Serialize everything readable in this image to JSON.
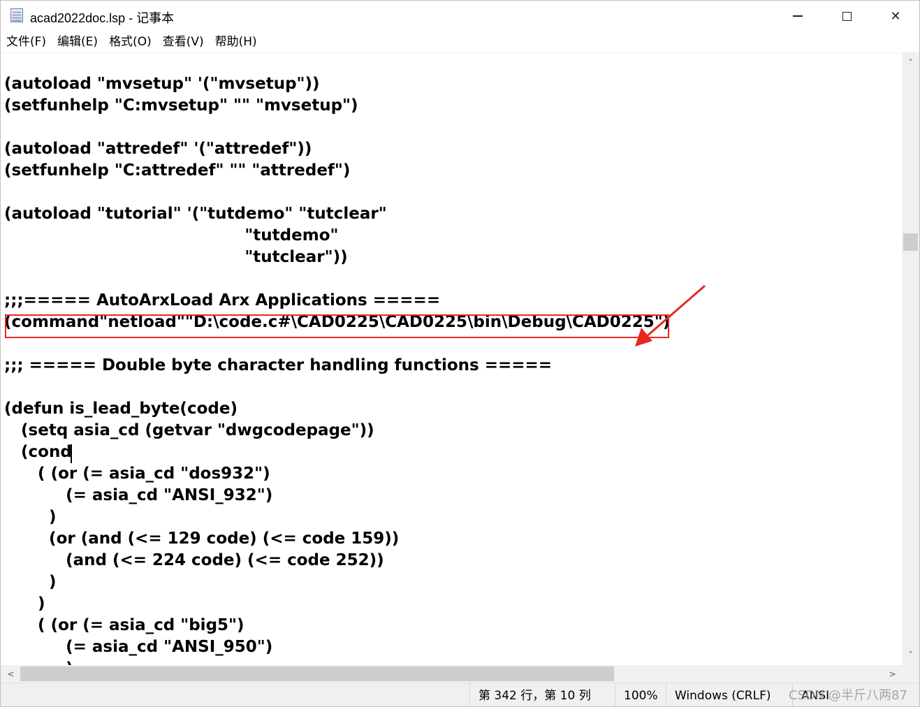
{
  "window": {
    "title": "acad2022doc.lsp - 记事本",
    "minimize_icon": "minimize-icon",
    "maximize_icon": "maximize-icon",
    "close_icon": "close-icon",
    "close_glyph": "✕"
  },
  "menu": {
    "items": [
      "文件(F)",
      "编辑(E)",
      "格式(O)",
      "查看(V)",
      "帮助(H)"
    ]
  },
  "editor": {
    "text": "(autoload \"mvsetup\" '(\"mvsetup\"))\n(setfunhelp \"C:mvsetup\" \"\" \"mvsetup\")\n\n(autoload \"attredef\" '(\"attredef\"))\n(setfunhelp \"C:attredef\" \"\" \"attredef\")\n\n(autoload \"tutorial\" '(\"tutdemo\" \"tutclear\"\n                                           \"tutdemo\"\n                                           \"tutclear\"))\n\n;;;===== AutoArxLoad Arx Applications =====\n(command\"netload\"\"D:\\code.c#\\CAD0225\\CAD0225\\bin\\Debug\\CAD0225\")\n\n;;; ===== Double byte character handling functions =====\n\n(defun is_lead_byte(code)\n   (setq asia_cd (getvar \"dwgcodepage\"))\n   (cond\n      ( (or (= asia_cd \"dos932\")\n           (= asia_cd \"ANSI_932\")\n        )\n        (or (and (<= 129 code) (<= code 159))\n           (and (<= 224 code) (<= code 252))\n        )\n      )\n      ( (or (= asia_cd \"big5\")\n           (= asia_cd \"ANSI_950\")\n           )",
    "annotation": {
      "box_color": "#e8281f",
      "arrow_color": "#e8281f"
    }
  },
  "scrollbars": {
    "up_arrow": "˄",
    "down_arrow": "˅",
    "left_arrow": "<",
    "right_arrow": ">"
  },
  "status": {
    "position": "第 342 行，第 10 列",
    "zoom": "100%",
    "line_ending": "Windows (CRLF)",
    "encoding": "ANSI"
  },
  "watermark": "CSDN @半斤八两87"
}
